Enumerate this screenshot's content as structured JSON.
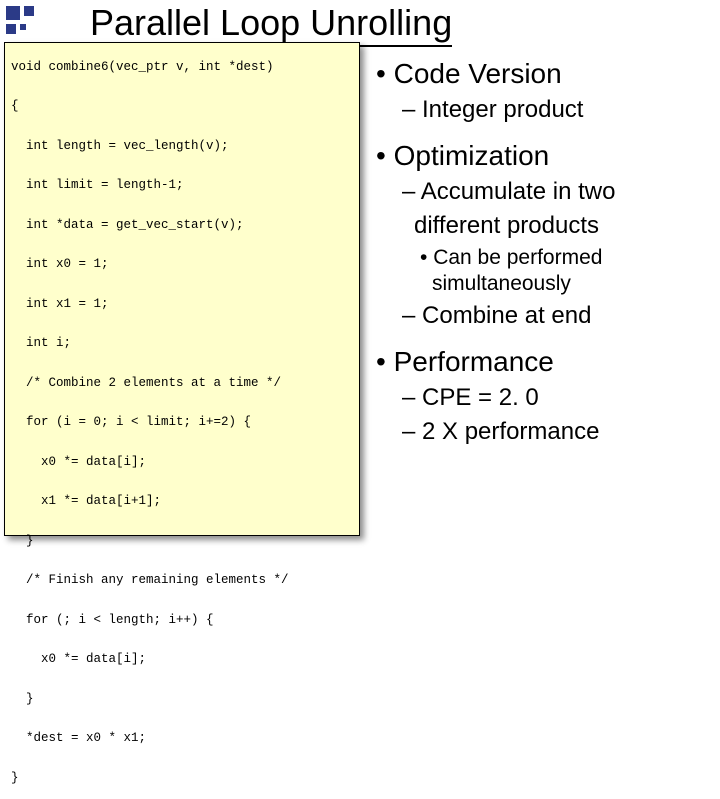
{
  "title": "Parallel Loop Unrolling",
  "code": {
    "l0": "void combine6(vec_ptr v, int *dest)",
    "l1": "{",
    "l2": "  int length = vec_length(v);",
    "l3": "  int limit = length-1;",
    "l4": "  int *data = get_vec_start(v);",
    "l5": "  int x0 = 1;",
    "l6": "  int x1 = 1;",
    "l7": "  int i;",
    "l8": "  /* Combine 2 elements at a time */",
    "l9": "  for (i = 0; i < limit; i+=2) {",
    "l10": "    x0 *= data[i];",
    "l11": "    x1 *= data[i+1];",
    "l12": "  }",
    "l13": "  /* Finish any remaining elements */",
    "l14": "  for (; i < length; i++) {",
    "l15": "    x0 *= data[i];",
    "l16": "  }",
    "l17": "  *dest = x0 * x1;",
    "l18": "}"
  },
  "bullets": {
    "b1a": "Code Version",
    "b2a": "Integer product",
    "b1b": "Optimization",
    "b2b_line1": "Accumulate in two",
    "b2b_line2": "different products",
    "b3a_line1": "Can be performed",
    "b3a_line2": "simultaneously",
    "b2c": "Combine at end",
    "b1c": "Performance",
    "b2d": "CPE = 2. 0",
    "b2e": "2 X performance"
  }
}
